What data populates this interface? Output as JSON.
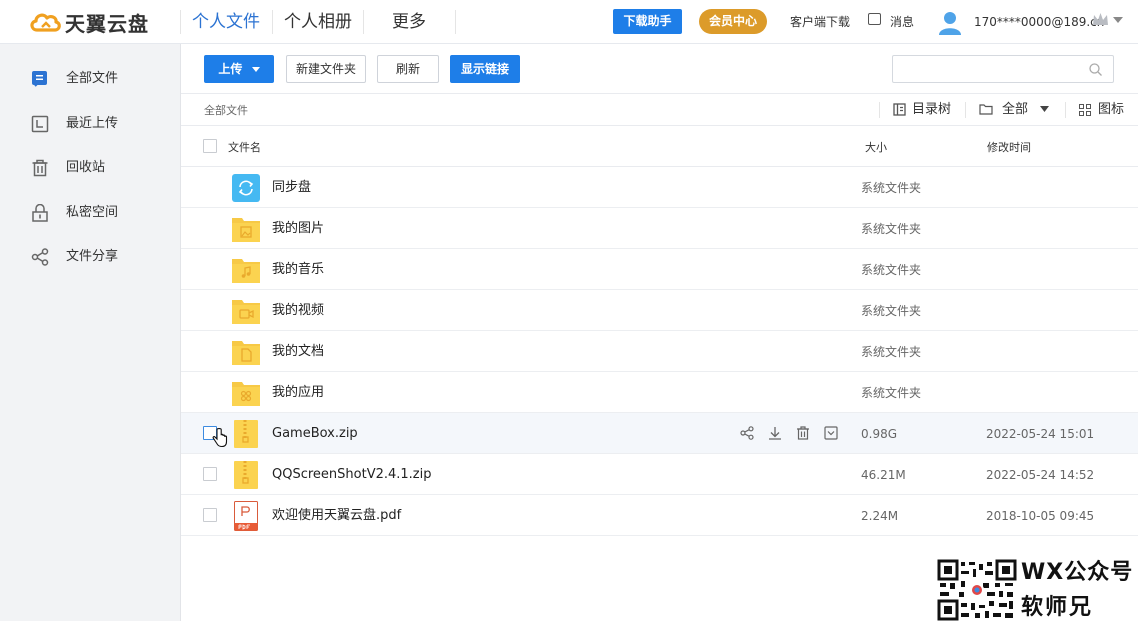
{
  "header": {
    "logo_text": "天翼云盘",
    "nav": [
      "个人文件",
      "个人相册",
      "更多"
    ],
    "download_btn": "下载助手",
    "vip_btn": "会员中心",
    "client_download": "客户端下载",
    "messages": "消息",
    "account": "170****0000@189.cn",
    "colors": {
      "accent": "#1e7ee8",
      "vip": "#dc9b2a",
      "active_nav": "#2c73d2"
    }
  },
  "sidebar": {
    "items": [
      {
        "label": "全部文件",
        "icon": "all-files-icon"
      },
      {
        "label": "最近上传",
        "icon": "recent-upload-icon"
      },
      {
        "label": "回收站",
        "icon": "trash-icon"
      },
      {
        "label": "私密空间",
        "icon": "lock-icon"
      },
      {
        "label": "文件分享",
        "icon": "share-icon"
      }
    ]
  },
  "toolbar": {
    "upload": "上传",
    "new_folder": "新建文件夹",
    "refresh": "刷新",
    "show_links": "显示链接",
    "search_placeholder": ""
  },
  "breadcrumb": "全部文件",
  "view": {
    "tree": "目录树",
    "filter": "全部",
    "grid": "图标"
  },
  "table": {
    "headers": {
      "name": "文件名",
      "size": "大小",
      "modified": "修改时间"
    },
    "rows": [
      {
        "name": "同步盘",
        "size": "系统文件夹",
        "time": "",
        "type": "sync"
      },
      {
        "name": "我的图片",
        "size": "系统文件夹",
        "time": "",
        "type": "folder-image"
      },
      {
        "name": "我的音乐",
        "size": "系统文件夹",
        "time": "",
        "type": "folder-music"
      },
      {
        "name": "我的视频",
        "size": "系统文件夹",
        "time": "",
        "type": "folder-video"
      },
      {
        "name": "我的文档",
        "size": "系统文件夹",
        "time": "",
        "type": "folder-doc"
      },
      {
        "name": "我的应用",
        "size": "系统文件夹",
        "time": "",
        "type": "folder-app"
      },
      {
        "name": "GameBox.zip",
        "size": "0.98G",
        "time": "2022-05-24 15:01",
        "type": "zip"
      },
      {
        "name": "QQScreenShotV2.4.1.zip",
        "size": "46.21M",
        "time": "2022-05-24 14:52",
        "type": "zip"
      },
      {
        "name": "欢迎使用天翼云盘.pdf",
        "size": "2.24M",
        "time": "2018-10-05 09:45",
        "type": "pdf"
      }
    ]
  },
  "watermark": {
    "line1": "WX公众号",
    "line2": "软师兄"
  }
}
